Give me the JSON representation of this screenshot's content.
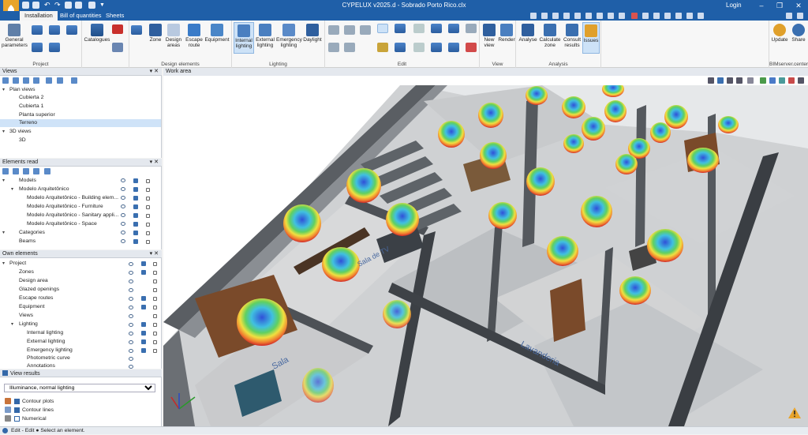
{
  "window": {
    "title": "CYPELUX v2025.d - Sobrado Porto Rico.clx",
    "login_label": "Login",
    "minimize": "–",
    "maximize": "❐",
    "close": "✕"
  },
  "tabs": [
    {
      "label": "Installation"
    },
    {
      "label": "Bill of quantities"
    },
    {
      "label": "Sheets"
    }
  ],
  "ribbon": {
    "project": {
      "label": "Project",
      "general_parameters": "General parameters"
    },
    "catalogues": {
      "label": "Catalogues"
    },
    "design_elements": {
      "label": "Design elements",
      "zone": "Zone",
      "design_areas": "Design areas",
      "escape_route": "Escape route",
      "equipment": "Equipment"
    },
    "lighting": {
      "label": "Lighting",
      "internal": "Internal lighting",
      "external": "External lighting",
      "emergency": "Emergency lighting",
      "daylight": "Daylight"
    },
    "edit": {
      "label": "Edit"
    },
    "view": {
      "label": "View",
      "new_view": "New view",
      "render": "Render"
    },
    "analysis": {
      "label": "Analysis",
      "analyse": "Analyse",
      "calculate_zone": "Calculate zone",
      "consult_results": "Consult results",
      "issues": "Issues"
    },
    "bimserver": {
      "label": "BIMserver.center",
      "update": "Update",
      "share": "Share"
    }
  },
  "views_panel": {
    "title": "Views",
    "plan_views": "Plan views",
    "plan_items": [
      "Cubierta 2",
      "Cubierta 1",
      "Planta superior",
      "Terreno"
    ],
    "selected_index": 3,
    "views_3d": "3D views",
    "items_3d": [
      "3D"
    ]
  },
  "elements_read": {
    "title": "Elements read",
    "models": "Models",
    "model_name": "Modelo Arquitetônico",
    "model_items": [
      "Modelo Arquitetônico - Building elem...",
      "Modelo Arquitetônico - Furniture",
      "Modelo Arquitetônico - Sanitary appli...",
      "Modelo Arquitetônico - Space"
    ],
    "categories": "Categories",
    "category_items": [
      "Beams"
    ]
  },
  "own_elements": {
    "title": "Own elements",
    "project": "Project",
    "items": [
      "Zones",
      "Design area",
      "Glazed openings",
      "Escape routes",
      "Equipment",
      "Views"
    ],
    "lighting": "Lighting",
    "lighting_items": [
      "Internal lighting",
      "External lighting",
      "Emergency lighting",
      "Photometric curve",
      "Annotations"
    ]
  },
  "view_results": {
    "title": "View results",
    "selected_option": "Illuminance, normal lighting",
    "options": [
      "Illuminance, normal lighting"
    ],
    "contour_plots": "Contour plots",
    "contour_lines": "Contour lines",
    "numerical": "Numerical"
  },
  "work_area": {
    "title": "Work area",
    "room_labels": [
      "Sala de TV",
      "Sala",
      "Lavanderia"
    ]
  },
  "status": {
    "text": "Edit - Edit  ●  Select an element."
  },
  "colors": {
    "titlebar": "#1f5fa8",
    "accent": "#3468a8",
    "selection": "#cfe3f8",
    "app_icon": "#e8a42b"
  }
}
